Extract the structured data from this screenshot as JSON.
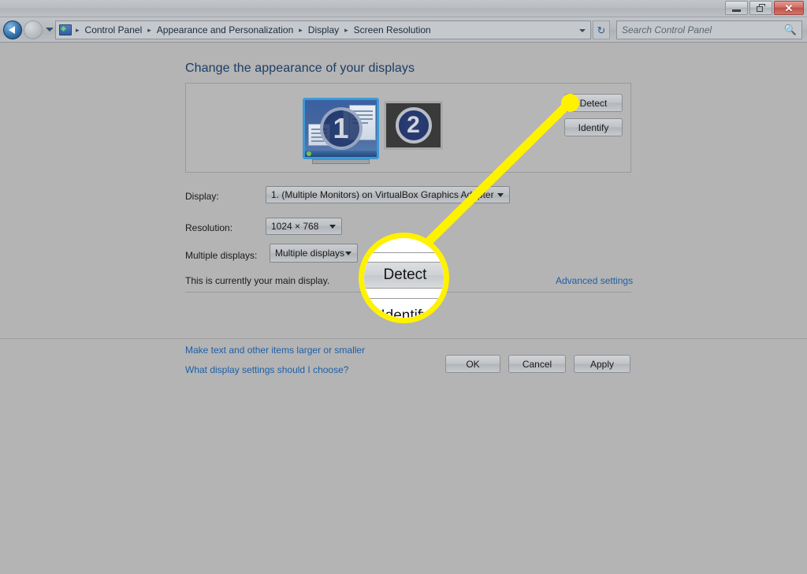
{
  "window": {
    "buttons": [
      {
        "name": "minimize",
        "glyph": "minimize-icon"
      },
      {
        "name": "restore",
        "glyph": "restore-icon"
      },
      {
        "name": "close",
        "glyph": "close-icon",
        "label": "✕"
      }
    ]
  },
  "navigation": {
    "back_label": "Back",
    "forward_label": "Forward",
    "history_label": "Recent pages",
    "refresh_label": "↻",
    "breadcrumb": [
      "Control Panel",
      "Appearance and Personalization",
      "Display",
      "Screen Resolution"
    ],
    "separator": "▸"
  },
  "search": {
    "placeholder": "Search Control Panel",
    "value": "",
    "icon": "search-icon"
  },
  "main": {
    "heading": "Change the appearance of your displays",
    "preview": {
      "monitor1": {
        "number": "1",
        "selected": true
      },
      "monitor2": {
        "number": "2",
        "selected": false
      },
      "detect_label": "Detect",
      "identify_label": "Identify"
    },
    "fields": {
      "display_label": "Display:",
      "display_value": "1. (Multiple Monitors) on VirtualBox Graphics Adapter",
      "resolution_label": "Resolution:",
      "resolution_value": "1024 × 768",
      "multiple_label": "Multiple displays:",
      "multiple_value": "Multiple displays"
    },
    "main_display_note": "This is currently your main display.",
    "advanced_settings_link": "Advanced settings",
    "links": [
      "Make text and other items larger or smaller",
      "What display settings should I choose?"
    ],
    "actions": {
      "ok": "OK",
      "cancel": "Cancel",
      "apply": "Apply"
    }
  },
  "callout": {
    "magnified_primary": "Detect",
    "magnified_secondary": "Identify",
    "highlight_color": "#fff200",
    "target": "detect-button"
  }
}
